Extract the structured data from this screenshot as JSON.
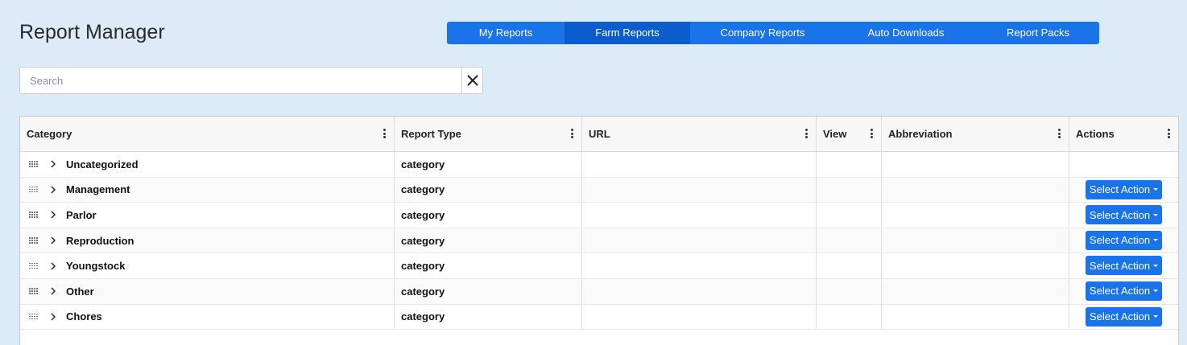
{
  "page": {
    "title": "Report Manager"
  },
  "tabs": [
    {
      "label": "My Reports",
      "active": false
    },
    {
      "label": "Farm Reports",
      "active": true
    },
    {
      "label": "Company Reports",
      "active": false
    },
    {
      "label": "Auto Downloads",
      "active": false
    },
    {
      "label": "Report Packs",
      "active": false
    }
  ],
  "search": {
    "placeholder": "Search",
    "value": "",
    "clear_icon": "close-icon"
  },
  "grid": {
    "columns": [
      "Category",
      "Report Type",
      "URL",
      "View",
      "Abbreviation",
      "Actions"
    ],
    "action_label": "Select Action",
    "rows": [
      {
        "category": "Uncategorized",
        "type": "category",
        "url": "",
        "view": "",
        "abbreviation": "",
        "has_action": false
      },
      {
        "category": "Management",
        "type": "category",
        "url": "",
        "view": "",
        "abbreviation": "",
        "has_action": true
      },
      {
        "category": "Parlor",
        "type": "category",
        "url": "",
        "view": "",
        "abbreviation": "",
        "has_action": true
      },
      {
        "category": "Reproduction",
        "type": "category",
        "url": "",
        "view": "",
        "abbreviation": "",
        "has_action": true
      },
      {
        "category": "Youngstock",
        "type": "category",
        "url": "",
        "view": "",
        "abbreviation": "",
        "has_action": true
      },
      {
        "category": "Other",
        "type": "category",
        "url": "",
        "view": "",
        "abbreviation": "",
        "has_action": true
      },
      {
        "category": "Chores",
        "type": "category",
        "url": "",
        "view": "",
        "abbreviation": "",
        "has_action": true
      }
    ]
  },
  "colors": {
    "accent": "#1a73e8",
    "accent_active": "#0b5ccc",
    "background": "#ddebf9"
  }
}
